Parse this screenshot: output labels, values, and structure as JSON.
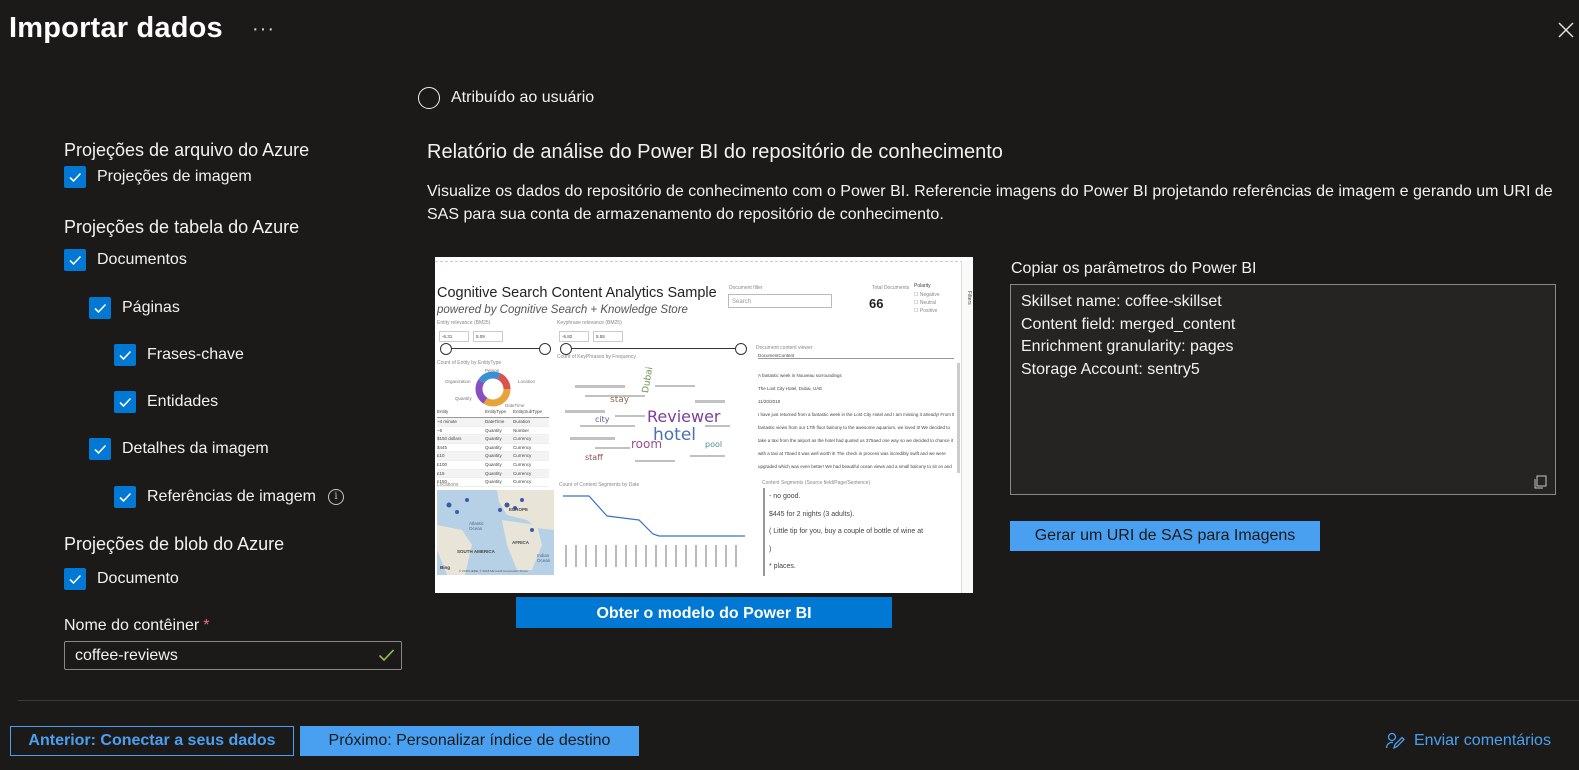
{
  "header": {
    "title": "Importar dados",
    "more_label": "···"
  },
  "radio": {
    "label": "Atribuído ao usuário"
  },
  "projections": {
    "file_section": "Projeções de arquivo do Azure",
    "image_projections": "Projeções de imagem",
    "table_section": "Projeções de tabela do Azure",
    "documents": "Documentos",
    "pages": "Páginas",
    "key_phrases": "Frases-chave",
    "entities": "Entidades",
    "image_details": "Detalhes da imagem",
    "image_references": "Referências de imagem",
    "blob_section": "Projeções de blob do Azure",
    "document": "Documento",
    "info_glyph": "i"
  },
  "container": {
    "label": "Nome do contêiner",
    "required_mark": "*",
    "value": "coffee-reviews"
  },
  "powerbi": {
    "title": "Relatório de análise do Power BI do repositório de conhecimento",
    "description": "Visualize os dados do repositório de conhecimento com o Power BI. Referencie imagens do Power BI projetando referências de imagem e gerando um URI de SAS para sua conta de armazenamento do repositório de conhecimento.",
    "get_template_button": "Obter o modelo do Power BI",
    "copy_label": "Copiar os parâmetros do Power BI",
    "parameters": [
      "Skillset name: coffee-skillset",
      "Content field: merged_content",
      "Enrichment granularity: pages",
      "Storage Account: sentry5"
    ],
    "sas_button": "Gerar um URI de SAS para Imagens"
  },
  "preview": {
    "title": "Cognitive Search Content Analytics Sample",
    "subtitle": "powered by Cognitive Search + Knowledge Store",
    "search_placeholder": "Search",
    "doc_filter_label": "Document filter",
    "total_docs_label": "Total Documents",
    "total_docs": "66",
    "polarity_label": "Polarity",
    "polarity": [
      "Negative",
      "Neutral",
      "Positive"
    ],
    "filters_label": "Filters",
    "entity_relevance_label": "Entity relevance (BM25)",
    "entity_min": "-6.31",
    "entity_max": "5.09",
    "keyphrase_relevance_label": "Keyphrase relevance (BM25)",
    "keyphrase_min": "-6.82",
    "keyphrase_max": "5.55",
    "donut_label": "Count of Entity by EntityType",
    "donut_legend": [
      "Person",
      "Organization",
      "Location",
      "Quantity",
      "DateTime"
    ],
    "keyphrase_chart_label": "Count of KeyPhrases by Frequency",
    "doc_viewer_label": "Document content viewer",
    "doc_col": "DocumentContent",
    "doc_lines": [
      "A fantastic week in Nouveau surroundings",
      "The Lost City Hotel, Dubai, UAE",
      "11/20/2018",
      "I have just returned from a fantastic week in the Lost City Hotel and I am missing it already! From the",
      "fantastic views from our 17th floor balcony to the awesome aquarium, we loved it! We decided to",
      "take a taxi from the airport as the hotel had quoted us 375aed one way so we decided to chance it",
      "with a taxi at 70aed it was well worth it! The check in process was incredibly swift and we were",
      "upgraded which was even better! We had beautiful ocean views and a small balcony to sit on and"
    ],
    "table_headers": [
      "Entity",
      "EntityType",
      "EntitySubType"
    ],
    "table_rows": [
      [
        "~4 minute",
        "DateTime",
        "Duration"
      ],
      [
        "~5",
        "Quantity",
        "Number"
      ],
      [
        "$150 dollars",
        "Quantity",
        "Currency"
      ],
      [
        "$445",
        "Quantity",
        "Currency"
      ],
      [
        "£10",
        "Quantity",
        "Currency"
      ],
      [
        "£100",
        "Quantity",
        "Currency"
      ],
      [
        "£15",
        "Quantity",
        "Currency"
      ],
      [
        "£150",
        "Quantity",
        "Currency"
      ]
    ],
    "locations_label": "Locations",
    "map_labels": [
      "EUROPE",
      "AFRICA",
      "SOUTH AMERICA",
      "Atlantic Ocean",
      "Indian Ocean"
    ],
    "bing_label": "Bing",
    "map_credit": "© 2018 HERE, © 2018 Microsoft Corporation Terms",
    "line_chart_label": "Count of Content Segments by Date",
    "segments_label": "Content Segments (Source field/Page/Sentence)",
    "segments": [
      "- no good.",
      "$445 for 2 nights (3 adults).",
      "( Little tip for you, buy a couple of bottle of wine at",
      ")",
      "* places."
    ],
    "words": [
      "Reviewer",
      "hotel",
      "room",
      "Dubai",
      "stay",
      "city",
      "pool",
      "staff"
    ]
  },
  "footer": {
    "prev_button": "Anterior: Conectar a seus dados",
    "next_button": "Próximo: Personalizar índice de destino",
    "feedback": "Enviar comentários"
  },
  "colors": {
    "background": "#1b1a19",
    "accent": "#0078d4",
    "accent_light": "#4aa0f0",
    "text": "#f3f2f1",
    "required": "#f1707b",
    "valid": "#92c353"
  },
  "icons": {
    "more": "more-icon",
    "close": "close-icon",
    "checkbox": "checkmark-icon",
    "info": "info-icon",
    "valid": "checkmark-icon",
    "copy": "copy-icon",
    "feedback": "feedback-icon"
  }
}
